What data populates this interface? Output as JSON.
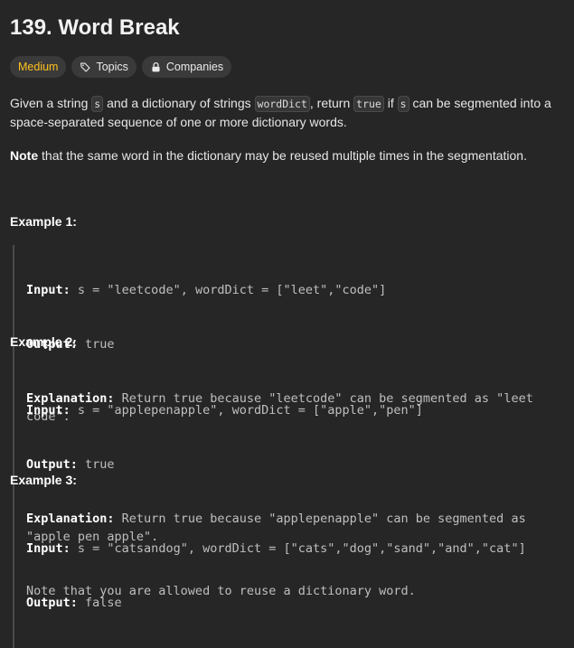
{
  "problem": {
    "title": "139. Word Break",
    "difficulty": "Medium",
    "topics_label": "Topics",
    "companies_label": "Companies",
    "desc_1": "Given a string ",
    "code_s": "s",
    "desc_2": " and a dictionary of strings ",
    "code_worddict": "wordDict",
    "desc_3": ", return ",
    "code_true": "true",
    "desc_4": " if ",
    "code_s2": "s",
    "desc_5": " can be segmented into a space-separated sequence of one or more dictionary words.",
    "note_bold": "Note",
    "note_rest": " that the same word in the dictionary may be reused multiple times in the segmentation."
  },
  "examples": [
    {
      "title": "Example 1:",
      "input_label": "Input:",
      "input": " s = \"leetcode\", wordDict = [\"leet\",\"code\"]",
      "output_label": "Output:",
      "output": " true",
      "explanation_label": "Explanation:",
      "explanation": " Return true because \"leetcode\" can be segmented as \"leet code\"."
    },
    {
      "title": "Example 2:",
      "input_label": "Input:",
      "input": " s = \"applepenapple\", wordDict = [\"apple\",\"pen\"]",
      "output_label": "Output:",
      "output": " true",
      "explanation_label": "Explanation:",
      "explanation": " Return true because \"applepenapple\" can be segmented as \"apple pen apple\".",
      "extra": "Note that you are allowed to reuse a dictionary word."
    },
    {
      "title": "Example 3:",
      "input_label": "Input:",
      "input": " s = \"catsandog\", wordDict = [\"cats\",\"dog\",\"sand\",\"and\",\"cat\"]",
      "output_label": "Output:",
      "output": " false"
    }
  ],
  "colors": {
    "background": "#262626",
    "difficulty_medium": "#ffc01e",
    "chip_bg": "#3a3a3a"
  },
  "icons": {
    "topics": "tag-icon",
    "companies": "lock-icon"
  }
}
